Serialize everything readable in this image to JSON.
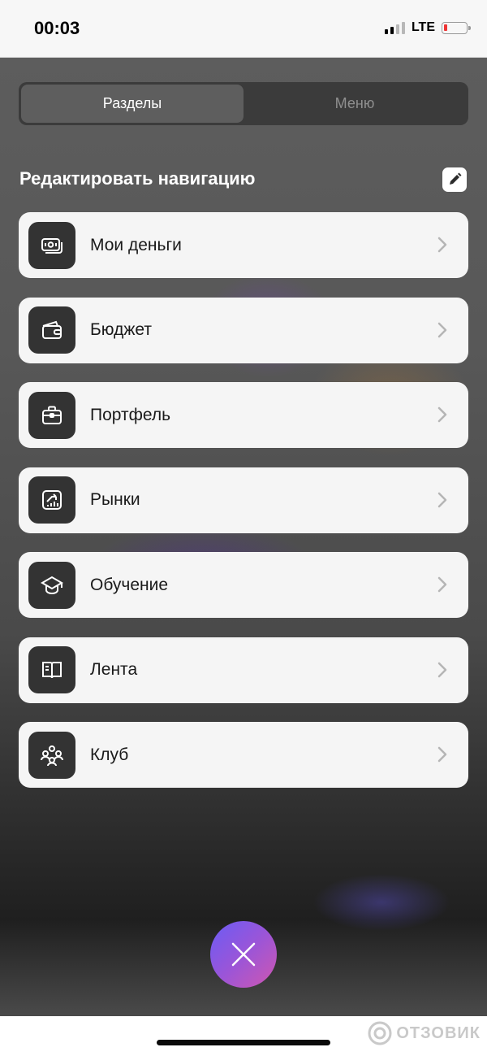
{
  "status_bar": {
    "time": "00:03",
    "network": "LTE"
  },
  "tabs": [
    {
      "label": "Разделы",
      "active": true
    },
    {
      "label": "Меню",
      "active": false
    }
  ],
  "section": {
    "title": "Редактировать навигацию",
    "edit_icon": "pencil-icon"
  },
  "nav_items": [
    {
      "label": "Мои деньги",
      "icon": "money-icon"
    },
    {
      "label": "Бюджет",
      "icon": "wallet-icon"
    },
    {
      "label": "Портфель",
      "icon": "briefcase-icon"
    },
    {
      "label": "Рынки",
      "icon": "chart-growth-icon"
    },
    {
      "label": "Обучение",
      "icon": "graduation-cap-icon"
    },
    {
      "label": "Лента",
      "icon": "book-icon"
    },
    {
      "label": "Клуб",
      "icon": "community-icon"
    }
  ],
  "close_button": {
    "icon": "close-icon"
  },
  "watermark": {
    "text": "ОТЗОВИК"
  },
  "colors": {
    "card_bg": "#f5f5f5",
    "icon_bg": "#333333",
    "fab_gradient_start": "#6a5cf5",
    "fab_gradient_end": "#d057b0"
  }
}
